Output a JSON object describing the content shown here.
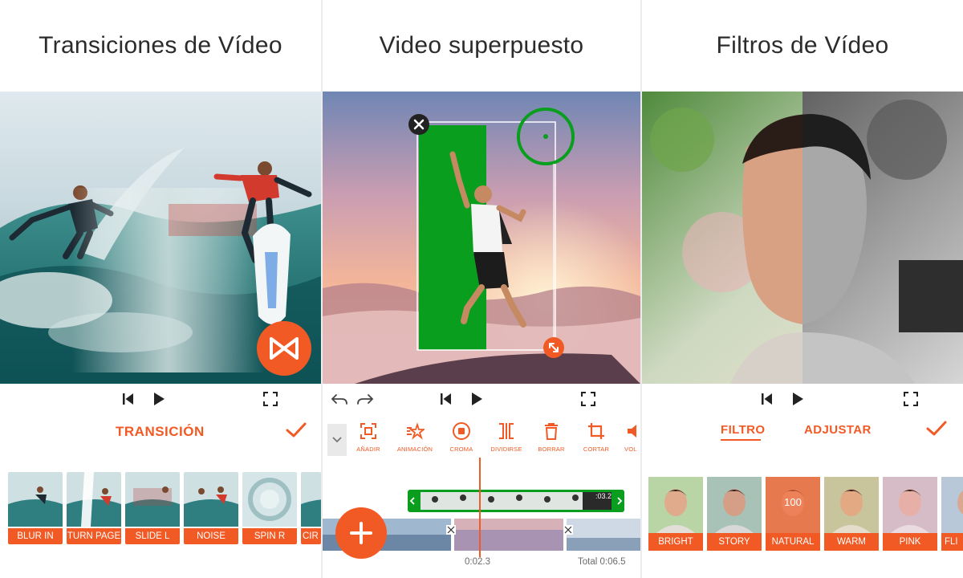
{
  "panels": {
    "transitions": {
      "title": "Transiciones de Vídeo",
      "section_label": "TRANSICIÓN",
      "items": [
        "BLUR IN",
        "TURN PAGE",
        "SLIDE L",
        "NOISE",
        "SPIN R",
        "CIR"
      ]
    },
    "overlay": {
      "title": "Video superpuesto",
      "tools": [
        "AÑADIR",
        "ANIMACIÓN",
        "CROMA",
        "DIVIDIRSE",
        "BORRAR",
        "CORTAR",
        "VOL"
      ],
      "clip_time": ":03.2",
      "current_time": "0:02.3",
      "total_time": "Total 0:06.5"
    },
    "filters": {
      "title": "Filtros de Vídeo",
      "tabs": [
        "FILTRO",
        "ADJUSTAR"
      ],
      "items": [
        "BRIGHT",
        "STORY",
        "NATURAL",
        "WARM",
        "PINK",
        "FLI"
      ],
      "selected_value": "100"
    }
  },
  "colors": {
    "accent": "#f15a24",
    "chroma_green": "#0a9e1e",
    "text_dark": "#2b2b2b"
  },
  "icons": [
    "skip-back-icon",
    "play-icon",
    "fullscreen-icon",
    "checkmark-icon",
    "transition-bowtie-icon",
    "undo-icon",
    "redo-icon",
    "close-icon",
    "resize-icon",
    "add-icon",
    "chevron-down-icon"
  ]
}
